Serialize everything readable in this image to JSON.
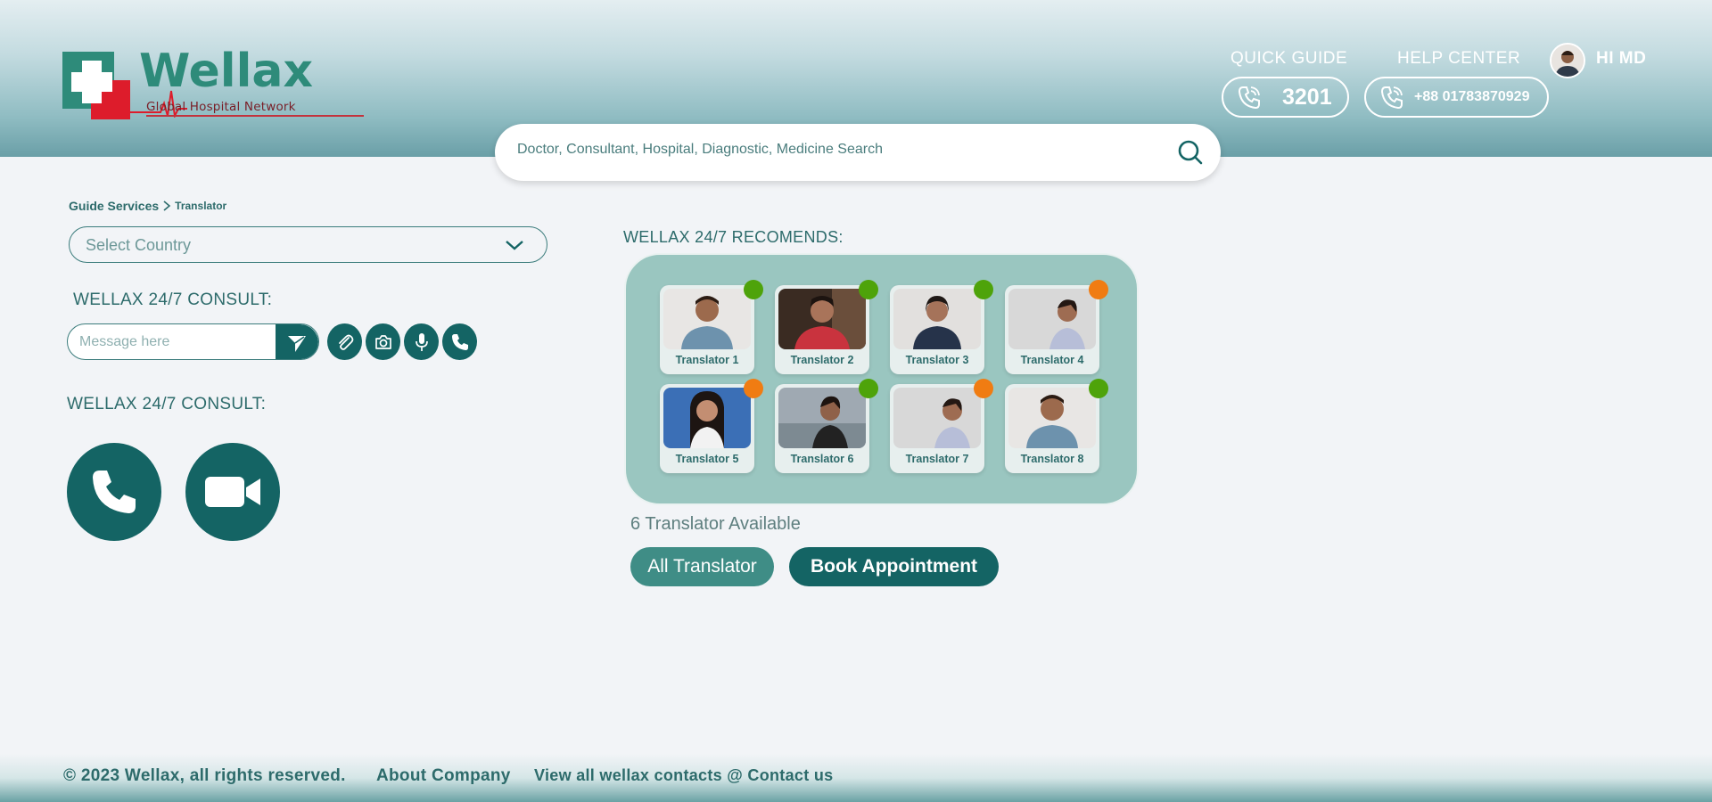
{
  "brand": {
    "name": "Wellax",
    "tagline": "Global Hospital Network"
  },
  "header": {
    "quick_guide": {
      "label": "QUICK GUIDE",
      "number": "3201"
    },
    "help_center": {
      "label": "HELP CENTER",
      "number": "+88 01783870929"
    },
    "user_greeting": "HI MD"
  },
  "search": {
    "placeholder": "Doctor, Consultant, Hospital, Diagnostic, Medicine Search"
  },
  "breadcrumb": {
    "parent": "Guide Services",
    "separator": ">",
    "current": "Translator"
  },
  "country_select": {
    "placeholder": "Select Country"
  },
  "consult_chat": {
    "title": "WELLAX 24/7 CONSULT:",
    "message_placeholder": "Message here"
  },
  "consult_call": {
    "title": "WELLAX 24/7 CONSULT:"
  },
  "recommends": {
    "title": "WELLAX 24/7 RECOMENDS:",
    "translators": [
      {
        "name": "Translator 1",
        "status": "online",
        "status_color": "#4ea30a"
      },
      {
        "name": "Translator 2",
        "status": "online",
        "status_color": "#4ea30a"
      },
      {
        "name": "Translator 3",
        "status": "online",
        "status_color": "#4ea30a"
      },
      {
        "name": "Translator 4",
        "status": "busy",
        "status_color": "#f07c12"
      },
      {
        "name": "Translator 5",
        "status": "busy",
        "status_color": "#f07c12"
      },
      {
        "name": "Translator 6",
        "status": "online",
        "status_color": "#4ea30a"
      },
      {
        "name": "Translator 7",
        "status": "busy",
        "status_color": "#f07c12"
      },
      {
        "name": "Translator 8",
        "status": "online",
        "status_color": "#4ea30a"
      }
    ],
    "available_text": "6 Translator Available",
    "all_button": "All Translator",
    "book_button": "Book Appointment"
  },
  "footer": {
    "copyright": "© 2023 Wellax, all rights reserved.",
    "about": "About Company",
    "contacts": "View all wellax contacts @ Contact us"
  },
  "colors": {
    "primary": "#146464",
    "accent": "#2e8b7a",
    "red": "#dd1c2b",
    "panel": "#9ac6c0"
  },
  "icons": [
    "phone-icon",
    "search-icon",
    "chevron-down-icon",
    "send-icon",
    "paperclip-icon",
    "camera-icon",
    "mic-icon",
    "video-icon"
  ]
}
